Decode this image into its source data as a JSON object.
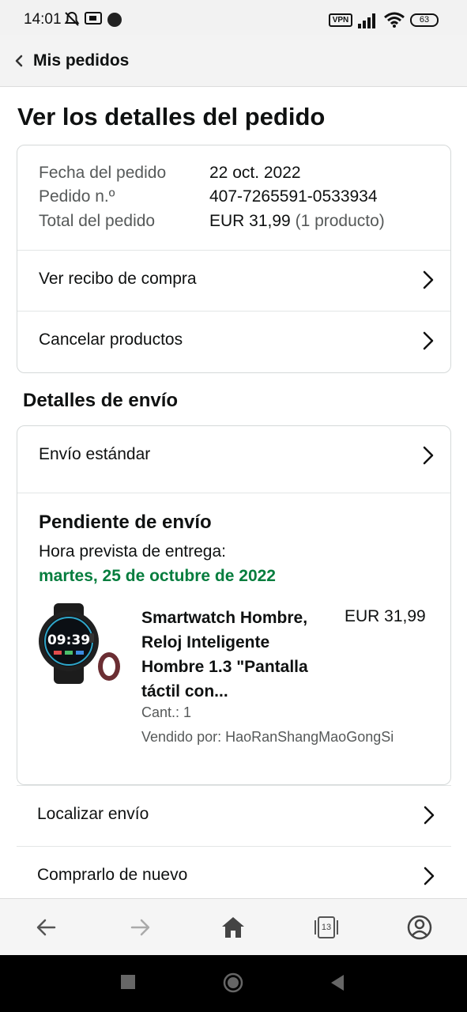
{
  "status_bar": {
    "time": "14:01",
    "vpn_label": "VPN",
    "battery_level": "63",
    "icons": [
      "notifications-off-icon",
      "cast-icon",
      "dot-icon",
      "signal-icon",
      "wifi-icon",
      "battery-icon"
    ]
  },
  "nav": {
    "back_label": "Mis pedidos"
  },
  "page": {
    "title": "Ver los detalles del pedido"
  },
  "order_summary": {
    "date_label": "Fecha del pedido",
    "date_value": "22 oct. 2022",
    "number_label": "Pedido n.º",
    "number_value": "407-7265591-0533934",
    "total_label": "Total del pedido",
    "total_value": "EUR 31,99",
    "total_count": "(1 producto)",
    "links": [
      {
        "label": "Ver recibo de compra"
      },
      {
        "label": "Cancelar productos"
      }
    ]
  },
  "shipping": {
    "section_title": "Detalles de envío",
    "method_label": "Envío estándar",
    "status_title": "Pendiente de envío",
    "eta_label": "Hora prevista de entrega:",
    "eta_date": "martes, 25 de octubre de 2022",
    "eta_color": "#067d3e",
    "product": {
      "title": "Smartwatch Hombre, Reloj Inteligente Hombre 1.3 \"Pantalla táctil con...",
      "price": "EUR 31,99",
      "quantity": "Cant.: 1",
      "seller": "Vendido por: HaoRanShangMaoGongSi",
      "watch_face_time": "09:39"
    }
  },
  "actions": [
    {
      "label": "Localizar envío"
    },
    {
      "label": "Comprarlo de nuevo"
    }
  ],
  "toolbar": {
    "tab_count": "13",
    "icons": [
      "back-arrow-icon",
      "forward-arrow-icon",
      "home-icon",
      "tabs-icon",
      "account-icon"
    ]
  },
  "android_nav": {
    "icons": [
      "recents-square-icon",
      "home-circle-icon",
      "back-triangle-icon"
    ]
  }
}
